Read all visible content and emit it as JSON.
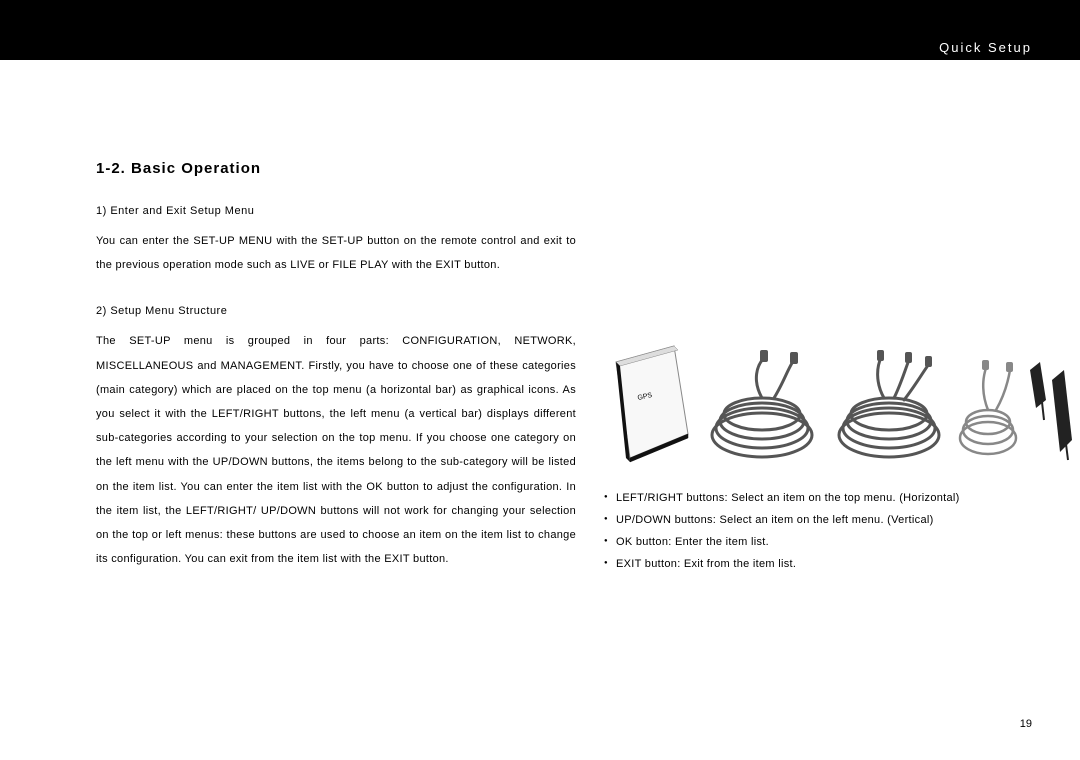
{
  "header": {
    "title": "Quick Setup"
  },
  "section": {
    "title": "1-2. Basic Operation",
    "sub1_heading": "1) Enter and Exit Setup Menu",
    "sub1_body": "You can enter the SET-UP MENU with the SET-UP button on the remote control and exit to the previous operation mode such as LIVE or FILE PLAY with the EXIT button.",
    "sub2_heading": "2) Setup Menu Structure",
    "sub2_body": "The SET-UP menu is grouped in four parts: CONFIGURATION, NETWORK, MISCELLANEOUS and MANAGEMENT. Firstly, you have to choose one of these categories (main category) which are placed on the top menu (a horizontal bar) as graphical icons. As you select it with the LEFT/RIGHT buttons, the left menu (a vertical bar) displays different sub-categories according to your selection on the top menu. If you choose one category on the left menu with the UP/DOWN buttons, the items belong to the sub-category will be listed on the item list. You can enter the item list with the OK button to adjust the configuration. In the item list, the LEFT/RIGHT/ UP/DOWN buttons will not work for changing your selection on the top or left menus: these buttons are used to choose an item on the item list to change its configuration. You can exit from the item list with the EXIT button."
  },
  "bullets": [
    "LEFT/RIGHT buttons: Select an item on the top menu. (Horizontal)",
    "UP/DOWN buttons: Select an item on the left menu. (Vertical)",
    "OK button: Enter the item list.",
    "EXIT button: Exit from the item list."
  ],
  "page_number": "19",
  "figure": {
    "items": [
      "manual-booklet",
      "av-cable-1",
      "av-cable-2",
      "component-cable",
      "rca-adapter"
    ]
  }
}
